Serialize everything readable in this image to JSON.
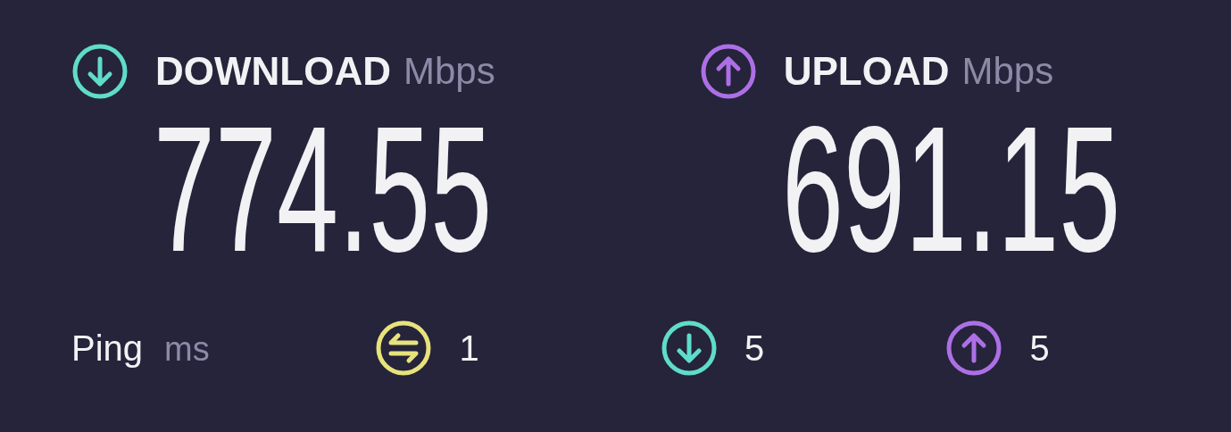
{
  "metrics": [
    {
      "kind": "download",
      "label": "DOWNLOAD",
      "unit": "Mbps",
      "value": "774.55"
    },
    {
      "kind": "upload",
      "label": "UPLOAD",
      "unit": "Mbps",
      "value": "691.15"
    }
  ],
  "ping": {
    "label": "Ping",
    "unit": "ms",
    "readings": [
      {
        "kind": "jitter",
        "value": "1"
      },
      {
        "kind": "download",
        "value": "5"
      },
      {
        "kind": "upload",
        "value": "5"
      }
    ]
  }
}
